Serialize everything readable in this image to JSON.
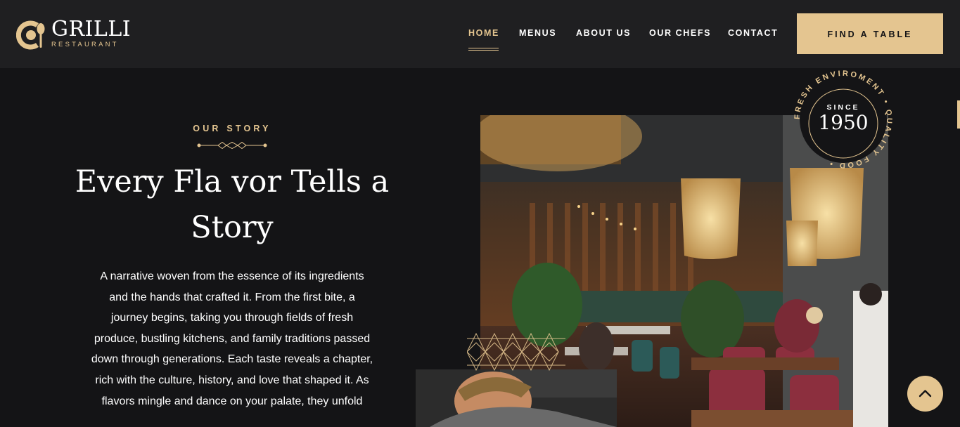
{
  "brand": {
    "name": "GRILLI",
    "subtitle": "RESTAURANT",
    "logo_icon": "cup-spoon-logo-icon"
  },
  "nav": {
    "items": [
      {
        "label": "HOME",
        "active": true
      },
      {
        "label": "MENUS",
        "active": false
      },
      {
        "label": "ABOUT US",
        "active": false
      },
      {
        "label": "OUR CHEFS",
        "active": false
      },
      {
        "label": "CONTACT",
        "active": false
      }
    ],
    "cta_label": "FIND A TABLE"
  },
  "story": {
    "eyebrow": "OUR STORY",
    "headline_line1": "Every Fla vor Tells a",
    "headline_line2": "Story",
    "paragraph_lines": [
      "A narrative woven from the essence of its ingredients",
      "and the hands that crafted it. From the first bite, a",
      "journey begins, taking you through fields of fresh",
      "produce, bustling kitchens, and family traditions passed",
      "down through generations. Each taste reveals a chapter,",
      "rich with the culture, history, and love that shaped it. As",
      "flavors mingle and dance on your palate, they unfold"
    ]
  },
  "badge": {
    "since": "SINCE",
    "year": "1950",
    "ring_text": "FRESH ENVIROMENT • QUALITY FOOD •"
  },
  "scroll_top": {
    "icon": "chevron-up-icon"
  },
  "colors": {
    "accent": "#e4c590",
    "background": "#141416",
    "header": "#1f1f21"
  }
}
